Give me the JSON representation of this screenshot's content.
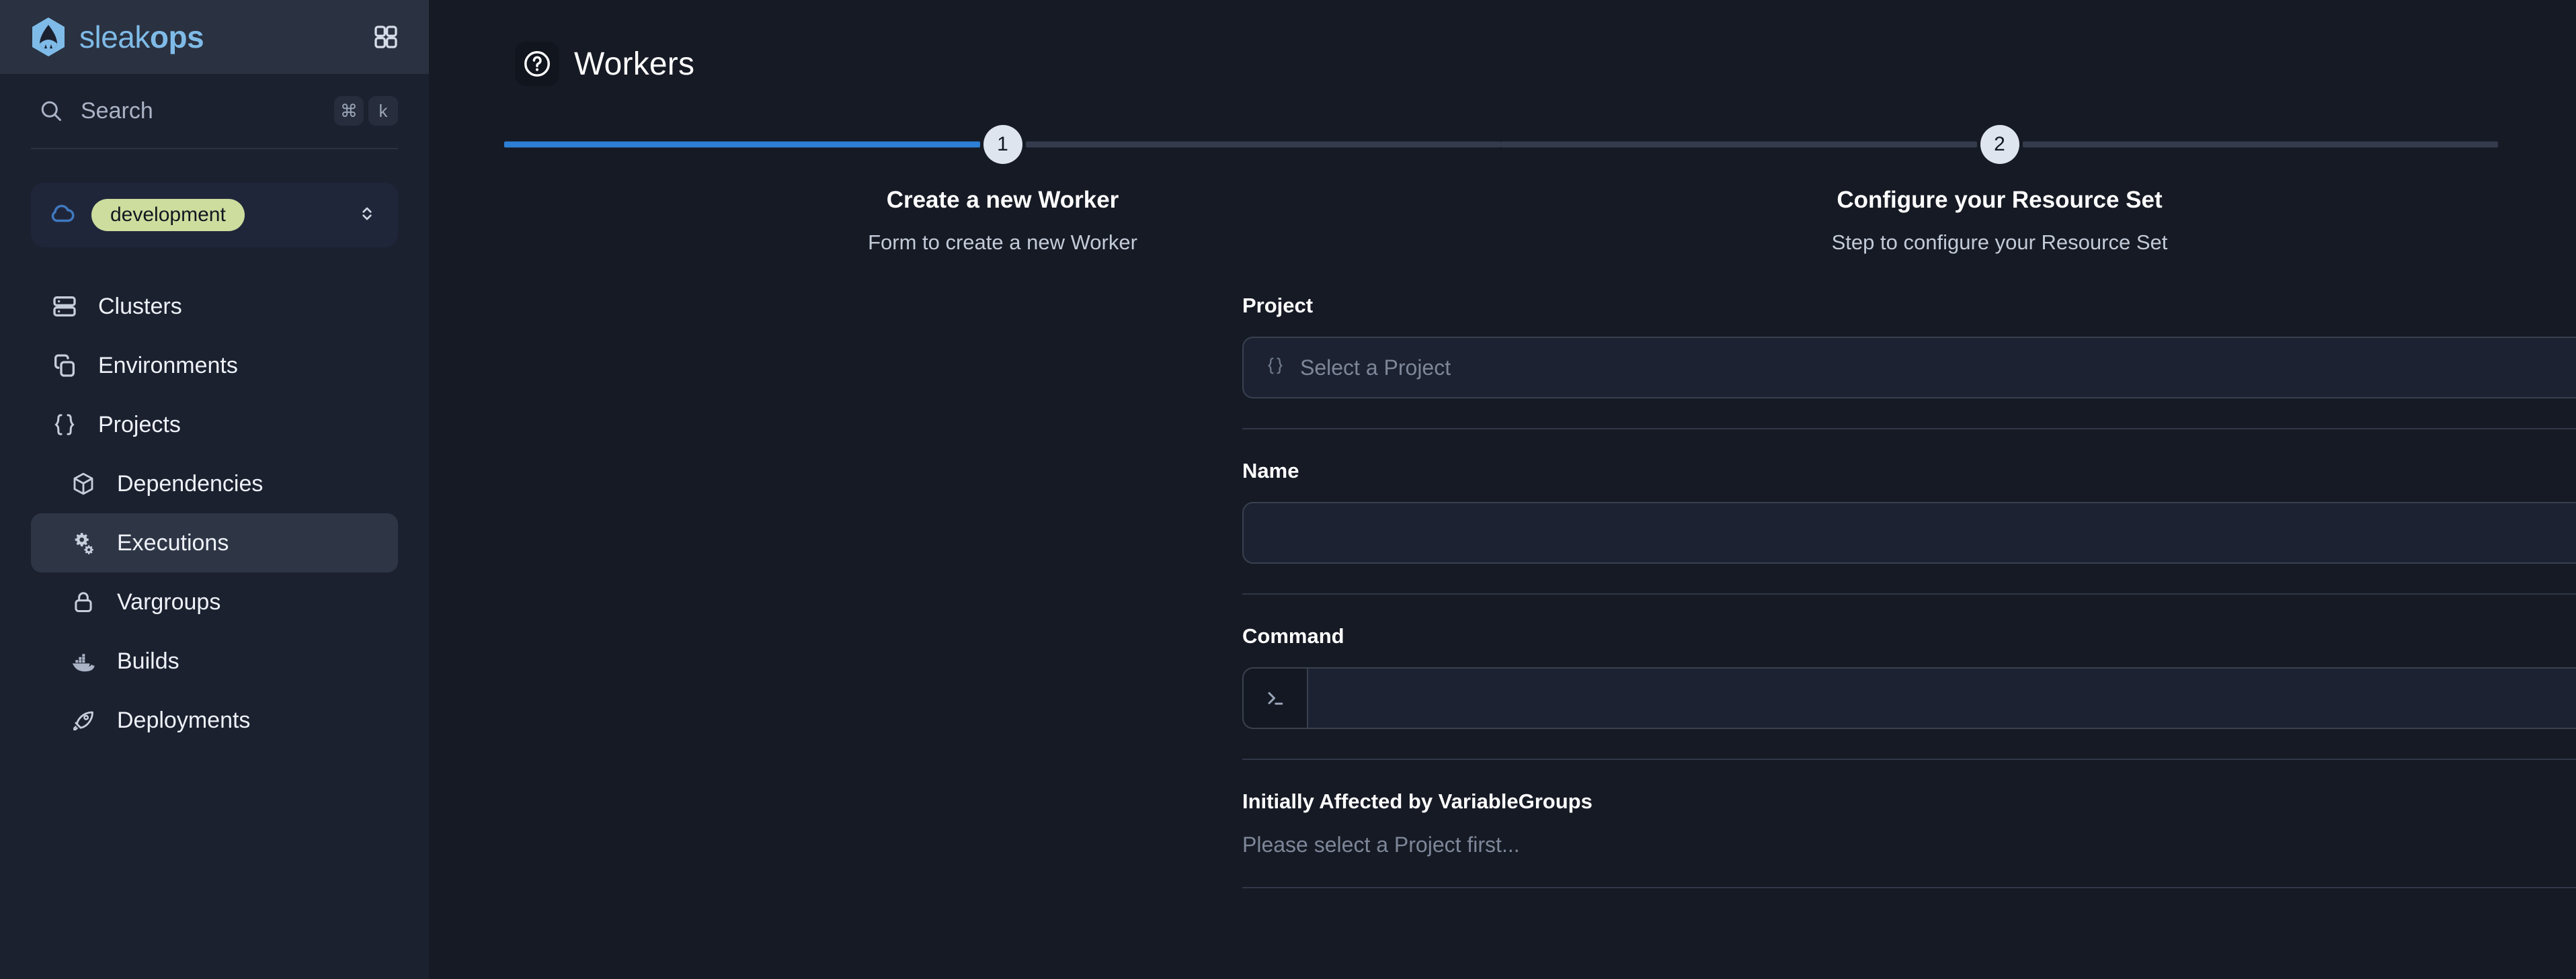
{
  "brand": {
    "name_thin": "sleak",
    "name_bold": "ops",
    "logo_icon": "sleakops-rocket-logo",
    "grid_toggle_icon": "grid-icon"
  },
  "search": {
    "label": "Search",
    "icon": "search-icon",
    "shortcut_keys": [
      "⌘",
      "k"
    ]
  },
  "environment": {
    "icon": "cloud-icon",
    "value": "development",
    "chevron_icon": "chevron-up-down-icon",
    "badge_color": "#ccdd9e"
  },
  "sidebar": {
    "items": [
      {
        "label": "Clusters",
        "icon": "server-icon",
        "sub": false,
        "active": false
      },
      {
        "label": "Environments",
        "icon": "copy-icon",
        "sub": false,
        "active": false
      },
      {
        "label": "Projects",
        "icon": "braces-icon",
        "sub": false,
        "active": false
      },
      {
        "label": "Dependencies",
        "icon": "box-icon",
        "sub": true,
        "active": false
      },
      {
        "label": "Executions",
        "icon": "gears-icon",
        "sub": true,
        "active": true
      },
      {
        "label": "Vargroups",
        "icon": "lock-icon",
        "sub": true,
        "active": false
      },
      {
        "label": "Builds",
        "icon": "docker-icon",
        "sub": true,
        "active": false
      },
      {
        "label": "Deployments",
        "icon": "rocket-icon",
        "sub": true,
        "active": false
      }
    ]
  },
  "page": {
    "title": "Workers",
    "icon": "question-circle-icon"
  },
  "stepper": {
    "accent_color": "#2c7fd4",
    "inactive_color": "#333b4d",
    "steps": [
      {
        "number": "1",
        "title": "Create a new Worker",
        "description": "Form to create a new Worker",
        "state": "active"
      },
      {
        "number": "2",
        "title": "Configure your Resource Set",
        "description": "Step to configure your Resource Set",
        "state": "upcoming"
      }
    ]
  },
  "form": {
    "project": {
      "label": "Project",
      "placeholder": "Select a Project",
      "value": "",
      "icon": "braces-icon"
    },
    "name": {
      "label": "Name",
      "placeholder": "",
      "value": ""
    },
    "command": {
      "label": "Command",
      "placeholder": "",
      "value": "",
      "prefix_icon": "terminal-icon"
    },
    "vargroups": {
      "label": "Initially Affected by VariableGroups",
      "empty_note": "Please select a Project first..."
    }
  }
}
